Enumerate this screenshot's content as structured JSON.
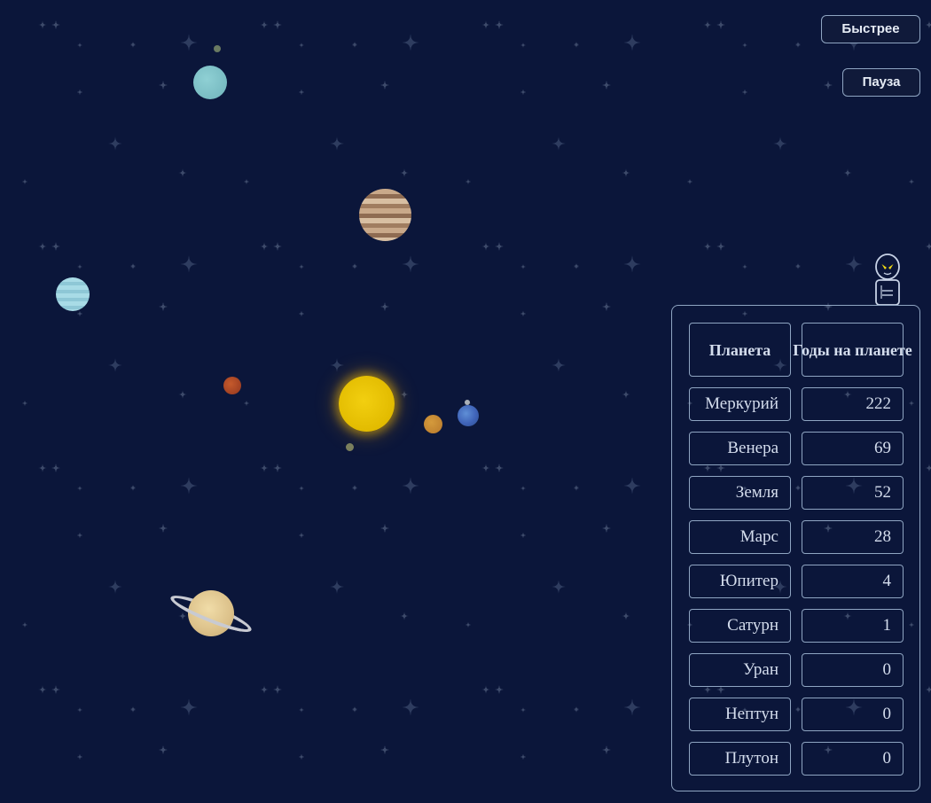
{
  "controls": {
    "faster_label": "Быстрее",
    "pause_label": "Пауза"
  },
  "table": {
    "header_planet": "Планета",
    "header_years": "Годы на планете",
    "rows": [
      {
        "planet": "Меркурий",
        "years": "222"
      },
      {
        "planet": "Венера",
        "years": "69"
      },
      {
        "planet": "Земля",
        "years": "52"
      },
      {
        "planet": "Марс",
        "years": "28"
      },
      {
        "planet": "Юпитер",
        "years": "4"
      },
      {
        "planet": "Сатурн",
        "years": "1"
      },
      {
        "planet": "Уран",
        "years": "0"
      },
      {
        "planet": "Нептун",
        "years": "0"
      },
      {
        "planet": "Плутон",
        "years": "0"
      }
    ]
  },
  "colors": {
    "background": "#0b163a",
    "border": "#8fa5c2",
    "text": "#d4dded",
    "sun": "#e2bb00"
  },
  "icons": {
    "alien": "alien-icon"
  }
}
